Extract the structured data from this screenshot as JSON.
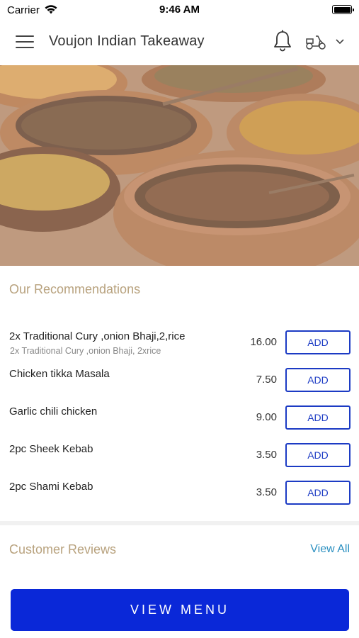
{
  "status_bar": {
    "carrier": "Carrier",
    "time": "9:46 AM"
  },
  "header": {
    "title": "Voujon Indian Takeaway"
  },
  "recommendations": {
    "title": "Our Recommendations",
    "add_label": "ADD",
    "items": [
      {
        "name": "2x Traditional Cury ,onion Bhaji,2,rice",
        "description": "2x Traditional Cury ,onion Bhaji, 2xrice",
        "price": "16.00"
      },
      {
        "name": "Chicken tikka Masala",
        "description": "",
        "price": "7.50"
      },
      {
        "name": "Garlic chili chicken",
        "description": "",
        "price": "9.00"
      },
      {
        "name": "2pc Sheek Kebab",
        "description": "",
        "price": "3.50"
      },
      {
        "name": "2pc Shami Kebab",
        "description": "",
        "price": "3.50"
      }
    ]
  },
  "reviews": {
    "title": "Customer Reviews",
    "view_all_label": "View All"
  },
  "footer": {
    "view_menu_label": "VIEW MENU"
  },
  "colors": {
    "accent_blue": "#1c3bc4",
    "button_blue": "#0a28d8",
    "section_title": "#b8a27e",
    "link": "#2a8fc0"
  }
}
